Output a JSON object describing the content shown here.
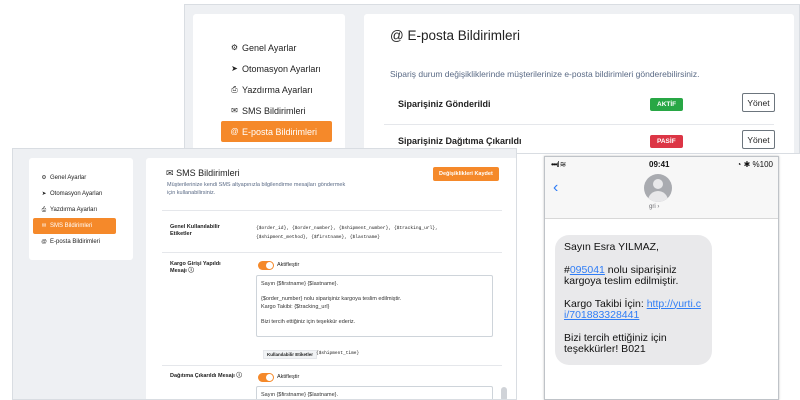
{
  "email_panel": {
    "sidebar": [
      {
        "icon": "gears-icon",
        "glyph": "⚙",
        "label": "Genel Ayarlar"
      },
      {
        "icon": "rocket-icon",
        "glyph": "➤",
        "label": "Otomasyon Ayarları"
      },
      {
        "icon": "printer-icon",
        "glyph": "⎙",
        "label": "Yazdırma Ayarları"
      },
      {
        "icon": "envelope-icon",
        "glyph": "✉",
        "label": "SMS Bildirimleri"
      },
      {
        "icon": "at-icon",
        "glyph": "@",
        "label": "E-posta Bildirimleri",
        "active": true
      }
    ],
    "title": "@ E-posta Bildirimleri",
    "description": "Sipariş durum değişikliklerinde müşterilerinize e-posta bildirimleri gönderebilirsiniz.",
    "rows": [
      {
        "label": "Siparişiniz Gönderildi",
        "status": "AKTİF",
        "status_color": "#28a745",
        "button": "Yönet"
      },
      {
        "label": "Siparişiniz Dağıtıma Çıkarıldı",
        "status": "PASİF",
        "status_color": "#dc3545",
        "button": "Yönet"
      }
    ]
  },
  "sms_panel": {
    "sidebar": [
      {
        "icon": "gears-icon",
        "glyph": "⚙",
        "label": "Genel Ayarlar"
      },
      {
        "icon": "rocket-icon",
        "glyph": "➤",
        "label": "Otomasyon Ayarları"
      },
      {
        "icon": "printer-icon",
        "glyph": "⎙",
        "label": "Yazdırma Ayarları"
      },
      {
        "icon": "envelope-icon",
        "glyph": "✉",
        "label": "SMS Bildirimleri",
        "active": true
      },
      {
        "icon": "at-icon",
        "glyph": "@",
        "label": "E-posta Bildirimleri"
      }
    ],
    "title_icon": "envelope-icon",
    "title": "SMS Bildirimleri",
    "description": "Müşterilerinize kendi SMS altyapınızla bilgilendirme mesajları göndermek için kullanabilirsiniz.",
    "save_button": "Değişiklikleri Kaydet",
    "general_tags": {
      "label": "Genel Kullanılabilir Etiketler",
      "value": "{$order_id}, {$order_number}, {$shipment_number}, {$tracking_url}, {$shipment_method}, {$firstname}, {$lastname}"
    },
    "cargo_entry": {
      "label": "Kargo Girişi Yapıldı Mesajı",
      "toggle_label": "Aktifleştir",
      "toggle_on": true,
      "message_lines": [
        "Sayın {$firstname} {$lastname}.",
        "",
        "{$order_number} nolu siparişiniz kargoya teslim edilmiştir.",
        "Kargo Takibi: {$tracking_url}",
        "",
        "Bizi tercih ettiğiniz için teşekkür ederiz."
      ],
      "extra_tag_label": "Kullanılabilir Etiketler",
      "extra_tag_value": "{$shipment_time}"
    },
    "distribution": {
      "label": "Dağıtıma Çıkarıldı Mesajı",
      "toggle_label": "Aktifleştir",
      "toggle_on": true,
      "message_lines": [
        "Sayın {$firstname} {$lastname}."
      ]
    }
  },
  "phone": {
    "status_left": "•••ıl ≋",
    "time": "09:41",
    "status_right": "◔ ✱ %100",
    "contact_name": "gri ›",
    "message": {
      "greeting": "Sayın Esra YILMAZ,",
      "order_prefix": "#",
      "order_number": "095041",
      "order_suffix": " nolu siparişiniz kargoya teslim edilmiştir.",
      "tracking_prefix": "Kargo Takibi İçin: ",
      "tracking_link": "http://yurti.ci/701883328441",
      "closing": "Bizi tercih ettiğiniz için teşekkürler! B021"
    }
  }
}
